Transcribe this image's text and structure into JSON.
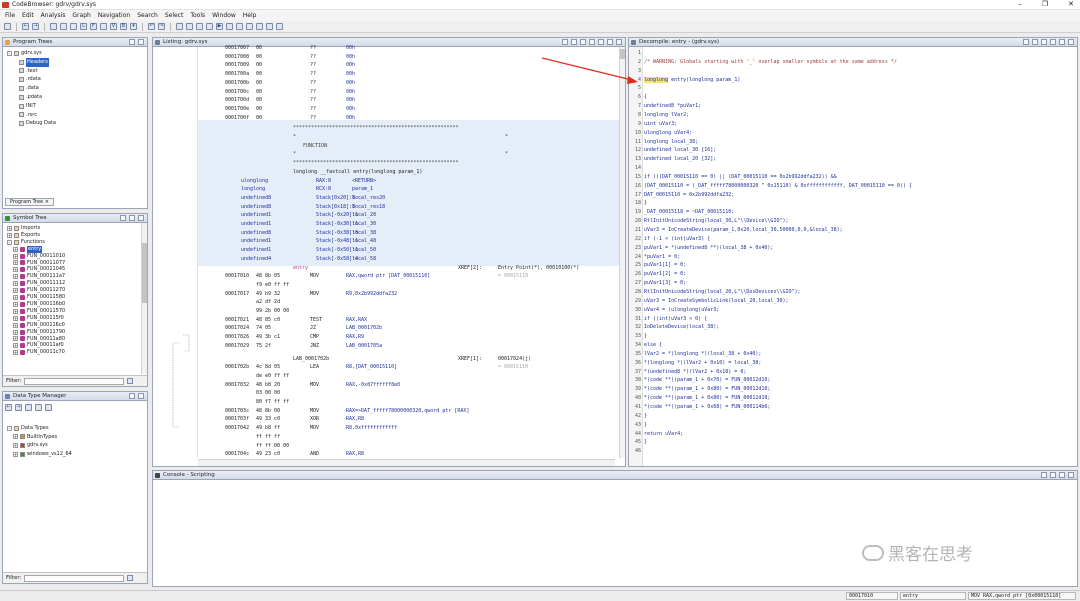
{
  "window": {
    "title": "CodeBrowser: gdrv/gdrv.sys",
    "min": "–",
    "max": "❐",
    "close": "✕"
  },
  "menu": [
    "File",
    "Edit",
    "Analysis",
    "Graph",
    "Navigation",
    "Search",
    "Select",
    "Tools",
    "Window",
    "Help"
  ],
  "program_trees": {
    "title": "Program Trees",
    "root": "gdrv.sys",
    "items": [
      "Headers",
      ".text",
      ".rdata",
      ".data",
      ".pdata",
      "INIT",
      ".rsrc",
      "Debug Data"
    ],
    "selected_item": "Headers",
    "tab": "Program Tree"
  },
  "symbol_tree": {
    "title": "Symbol Tree",
    "groups": [
      "Imports",
      "Exports",
      "Functions"
    ],
    "functions": [
      "entry",
      "FUN_00011010",
      "FUN_00011077",
      "FUN_00011045",
      "FUN_000111a7",
      "FUN_00011112",
      "FUN_00011270",
      "FUN_00011580",
      "FUN_000116b0",
      "FUN_00011570",
      "FUN_000115f0",
      "FUN_000116c0",
      "FUN_00011790",
      "FUN_00011a80",
      "FUN_00011af0",
      "FUN_00011c70"
    ],
    "selected_item": "entry",
    "filter_label": "Filter:"
  },
  "data_type_manager": {
    "title": "Data Type Manager",
    "root": "Data Types",
    "items": [
      "BuiltInTypes",
      "gdrv.sys",
      "windows_vs12_64"
    ],
    "filter_label": "Filter:"
  },
  "listing": {
    "title": "Listing:  gdrv.sys",
    "rows_top": [
      {
        "addr": "00017007",
        "bytes": "00",
        "mnem": "??",
        "op": "00h"
      },
      {
        "addr": "00017008",
        "bytes": "00",
        "mnem": "??",
        "op": "00h"
      },
      {
        "addr": "00017009",
        "bytes": "00",
        "mnem": "??",
        "op": "00h"
      },
      {
        "addr": "0001700a",
        "bytes": "00",
        "mnem": "??",
        "op": "00h"
      },
      {
        "addr": "0001700b",
        "bytes": "00",
        "mnem": "??",
        "op": "00h"
      },
      {
        "addr": "0001700c",
        "bytes": "00",
        "mnem": "??",
        "op": "00h"
      },
      {
        "addr": "0001700d",
        "bytes": "00",
        "mnem": "??",
        "op": "00h"
      },
      {
        "addr": "0001700e",
        "bytes": "00",
        "mnem": "??",
        "op": "00h"
      },
      {
        "addr": "0001700f",
        "bytes": "00",
        "mnem": "??",
        "op": "00h"
      }
    ],
    "stars": "*******************************************************",
    "star_edge": "*",
    "function_label": "FUNCTION",
    "signature": "longlong __fastcall entry(longlong param_1)",
    "vars": [
      {
        "type": "ulonglong",
        "storage": "RAX:8",
        "name": "<RETURN>"
      },
      {
        "type": "longlong",
        "storage": "RCX:8",
        "name": "param_1"
      },
      {
        "type": "undefined8",
        "storage": "Stack[0x20]:8",
        "name": "local_res20"
      },
      {
        "type": "undefined8",
        "storage": "Stack[0x18]:8",
        "name": "local_res18"
      },
      {
        "type": "undefined1",
        "storage": "Stack[-0x20]:1",
        "name": "local_20"
      },
      {
        "type": "undefined1",
        "storage": "Stack[-0x30]:1",
        "name": "local_30"
      },
      {
        "type": "undefined8",
        "storage": "Stack[-0x38]:8",
        "name": "local_38"
      },
      {
        "type": "undefined1",
        "storage": "Stack[-0x48]:1",
        "name": "local_48"
      },
      {
        "type": "undefined1",
        "storage": "Stack[-0x50]:1",
        "name": "local_50"
      },
      {
        "type": "undefined4",
        "storage": "Stack[-0x58]:4",
        "name": "local_58"
      }
    ],
    "entry_label": "entry",
    "entry_xref": "XREF[2]:",
    "entry_xref_val": "Entry Point(*), 00010100(*)",
    "entry_xref_val2": "= 00015110",
    "rows_code": [
      {
        "addr": "00017010",
        "bytes": "48 8b 05",
        "mnem": "MOV",
        "op": "RAX,qword ptr [DAT_00015110]"
      },
      {
        "addr": "",
        "bytes": "f9 e0 ff ff",
        "mnem": "",
        "op": ""
      },
      {
        "addr": "00017017",
        "bytes": "49 b9 32",
        "mnem": "MOV",
        "op": "R9,0x2b992ddfa232"
      },
      {
        "addr": "",
        "bytes": "a2 df 2d",
        "mnem": "",
        "op": ""
      },
      {
        "addr": "",
        "bytes": "99 2b 00 00",
        "mnem": "",
        "op": ""
      },
      {
        "addr": "00017021",
        "bytes": "48 85 c0",
        "mnem": "TEST",
        "op": "RAX,RAX"
      },
      {
        "addr": "00017024",
        "bytes": "74 05",
        "mnem": "JZ",
        "op": "LAB_0001702b"
      },
      {
        "addr": "00017026",
        "bytes": "49 3b c1",
        "mnem": "CMP",
        "op": "RAX,R9"
      },
      {
        "addr": "00017029",
        "bytes": "75 2f",
        "mnem": "JNZ",
        "op": "LAB_0001705a"
      }
    ],
    "lab_label": "LAB_0001702b",
    "lab_xref": "XREF[1]:",
    "lab_xref_val": "00017024(j)",
    "lab_xref_val2": "= 00015110",
    "rows_code2": [
      {
        "addr": "0001702b",
        "bytes": "4c 8d 05",
        "mnem": "LEA",
        "op": "R8,[DAT_00015110]"
      },
      {
        "addr": "",
        "bytes": "de e0 ff ff",
        "mnem": "",
        "op": ""
      },
      {
        "addr": "00017032",
        "bytes": "48 b8 20",
        "mnem": "MOV",
        "op": "RAX,-0x87ffffff8e0"
      },
      {
        "addr": "",
        "bytes": "03 00 00",
        "mnem": "",
        "op": ""
      },
      {
        "addr": "",
        "bytes": "80 f7 ff ff",
        "mnem": "",
        "op": ""
      },
      {
        "addr": "0001703c",
        "bytes": "48 8b 00",
        "mnem": "MOV",
        "op": "RAX=>DAT_fffff78000000320,qword ptr [RAX]"
      },
      {
        "addr": "0001703f",
        "bytes": "49 33 c0",
        "mnem": "XOR",
        "op": "RAX,R8"
      },
      {
        "addr": "00017042",
        "bytes": "49 b8 ff",
        "mnem": "MOV",
        "op": "R8,0xffffffffffff"
      },
      {
        "addr": "",
        "bytes": "ff ff ff",
        "mnem": "",
        "op": ""
      },
      {
        "addr": "",
        "bytes": "ff ff 00 00",
        "mnem": "",
        "op": ""
      },
      {
        "addr": "0001704c",
        "bytes": "49 23 c0",
        "mnem": "AND",
        "op": "RAX,R8"
      }
    ]
  },
  "decompile": {
    "title": "Decompile: entry - (gdrv.sys)",
    "lines": [
      "",
      "/* WARNING: Globals starting with '_' overlap smaller symbols at the same address */",
      "",
      "longlong entry(longlong param_1)",
      "",
      "{",
      "  undefined8 *puVar1;",
      "  longlong lVar2;",
      "  uint uVar3;",
      "  ulonglong uVar4;",
      "  longlong local_38;",
      "  undefined local_30 [16];",
      "  undefined local_20 [32];",
      "",
      "  if (((DAT_00015110 == 0) || (DAT_00015110 == 0x2b992ddfa232)) &&",
      "     (DAT_00015110 = (_DAT_fffff78000000320 ^ 0x15110) & 0xffffffffffff, DAT_00015110 == 0)) {",
      "    DAT_00015110 = 0x2b992ddfa232;",
      "  }",
      "  _DAT_00015118 = ~DAT_00015110;",
      "  RtlInitUnicodeString(local_30,L\"\\\\Device\\\\GIO\");",
      "  uVar3 = IoCreateDevice(param_1,0x20,local_30,50000,0,0,&local_38);",
      "  if (-1 < (int)uVar3) {",
      "    puVar1 = *(undefined8 **)(local_38 + 0x40);",
      "    *puVar1 = 0;",
      "    puVar1[1] = 0;",
      "    puVar1[2] = 0;",
      "    puVar1[3] = 0;",
      "    RtlInitUnicodeString(local_20,L\"\\\\DosDevices\\\\GIO\");",
      "    uVar3 = IoCreateSymbolicLink(local_20,local_30);",
      "    uVar4 = (ulonglong)uVar3;",
      "    if ((int)uVar3 < 0) {",
      "      IoDeleteDevice(local_38);",
      "    }",
      "    else {",
      "      lVar2 = *(longlong *)(local_38 + 0x40);",
      "      *(longlong *)(lVar2 + 0x10) = local_38;",
      "      *(undefined8 *)(lVar2 + 0x18) = 0;",
      "      *(code **)(param_1 + 0x70) = FUN_00012d10;",
      "      *(code **)(param_1 + 0x80) = FUN_00012d10;",
      "      *(code **)(param_1 + 0x80) = FUN_00012d10;",
      "      *(code **)(param_1 + 0x68) = FUN_000114b0;",
      "    }",
      "  }",
      "  return uVar4;",
      "}",
      ""
    ],
    "highlight_word": "longlong"
  },
  "console": {
    "title": "Console - Scripting"
  },
  "status": {
    "address": "00017010",
    "function": "entry",
    "instruction": "MOV RAX,qword ptr [0x00015110]"
  },
  "watermark": "黑客在思考"
}
